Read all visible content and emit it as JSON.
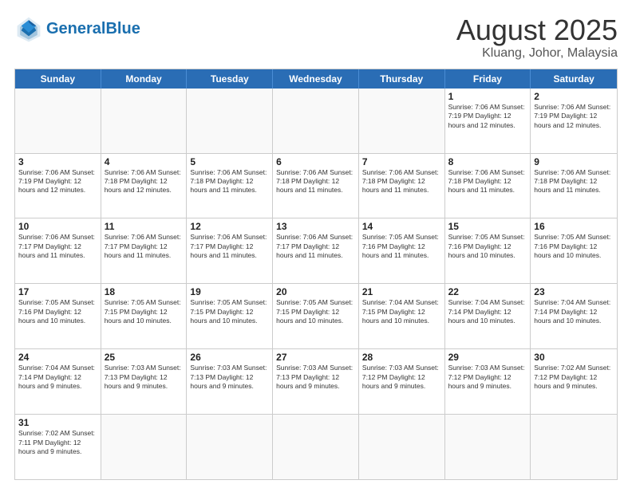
{
  "header": {
    "logo_general": "General",
    "logo_blue": "Blue",
    "month_year": "August 2025",
    "location": "Kluang, Johor, Malaysia"
  },
  "weekdays": [
    "Sunday",
    "Monday",
    "Tuesday",
    "Wednesday",
    "Thursday",
    "Friday",
    "Saturday"
  ],
  "weeks": [
    [
      {
        "day": "",
        "info": ""
      },
      {
        "day": "",
        "info": ""
      },
      {
        "day": "",
        "info": ""
      },
      {
        "day": "",
        "info": ""
      },
      {
        "day": "",
        "info": ""
      },
      {
        "day": "1",
        "info": "Sunrise: 7:06 AM\nSunset: 7:19 PM\nDaylight: 12 hours\nand 12 minutes."
      },
      {
        "day": "2",
        "info": "Sunrise: 7:06 AM\nSunset: 7:19 PM\nDaylight: 12 hours\nand 12 minutes."
      }
    ],
    [
      {
        "day": "3",
        "info": "Sunrise: 7:06 AM\nSunset: 7:19 PM\nDaylight: 12 hours\nand 12 minutes."
      },
      {
        "day": "4",
        "info": "Sunrise: 7:06 AM\nSunset: 7:18 PM\nDaylight: 12 hours\nand 12 minutes."
      },
      {
        "day": "5",
        "info": "Sunrise: 7:06 AM\nSunset: 7:18 PM\nDaylight: 12 hours\nand 11 minutes."
      },
      {
        "day": "6",
        "info": "Sunrise: 7:06 AM\nSunset: 7:18 PM\nDaylight: 12 hours\nand 11 minutes."
      },
      {
        "day": "7",
        "info": "Sunrise: 7:06 AM\nSunset: 7:18 PM\nDaylight: 12 hours\nand 11 minutes."
      },
      {
        "day": "8",
        "info": "Sunrise: 7:06 AM\nSunset: 7:18 PM\nDaylight: 12 hours\nand 11 minutes."
      },
      {
        "day": "9",
        "info": "Sunrise: 7:06 AM\nSunset: 7:18 PM\nDaylight: 12 hours\nand 11 minutes."
      }
    ],
    [
      {
        "day": "10",
        "info": "Sunrise: 7:06 AM\nSunset: 7:17 PM\nDaylight: 12 hours\nand 11 minutes."
      },
      {
        "day": "11",
        "info": "Sunrise: 7:06 AM\nSunset: 7:17 PM\nDaylight: 12 hours\nand 11 minutes."
      },
      {
        "day": "12",
        "info": "Sunrise: 7:06 AM\nSunset: 7:17 PM\nDaylight: 12 hours\nand 11 minutes."
      },
      {
        "day": "13",
        "info": "Sunrise: 7:06 AM\nSunset: 7:17 PM\nDaylight: 12 hours\nand 11 minutes."
      },
      {
        "day": "14",
        "info": "Sunrise: 7:05 AM\nSunset: 7:16 PM\nDaylight: 12 hours\nand 11 minutes."
      },
      {
        "day": "15",
        "info": "Sunrise: 7:05 AM\nSunset: 7:16 PM\nDaylight: 12 hours\nand 10 minutes."
      },
      {
        "day": "16",
        "info": "Sunrise: 7:05 AM\nSunset: 7:16 PM\nDaylight: 12 hours\nand 10 minutes."
      }
    ],
    [
      {
        "day": "17",
        "info": "Sunrise: 7:05 AM\nSunset: 7:16 PM\nDaylight: 12 hours\nand 10 minutes."
      },
      {
        "day": "18",
        "info": "Sunrise: 7:05 AM\nSunset: 7:15 PM\nDaylight: 12 hours\nand 10 minutes."
      },
      {
        "day": "19",
        "info": "Sunrise: 7:05 AM\nSunset: 7:15 PM\nDaylight: 12 hours\nand 10 minutes."
      },
      {
        "day": "20",
        "info": "Sunrise: 7:05 AM\nSunset: 7:15 PM\nDaylight: 12 hours\nand 10 minutes."
      },
      {
        "day": "21",
        "info": "Sunrise: 7:04 AM\nSunset: 7:15 PM\nDaylight: 12 hours\nand 10 minutes."
      },
      {
        "day": "22",
        "info": "Sunrise: 7:04 AM\nSunset: 7:14 PM\nDaylight: 12 hours\nand 10 minutes."
      },
      {
        "day": "23",
        "info": "Sunrise: 7:04 AM\nSunset: 7:14 PM\nDaylight: 12 hours\nand 10 minutes."
      }
    ],
    [
      {
        "day": "24",
        "info": "Sunrise: 7:04 AM\nSunset: 7:14 PM\nDaylight: 12 hours\nand 9 minutes."
      },
      {
        "day": "25",
        "info": "Sunrise: 7:03 AM\nSunset: 7:13 PM\nDaylight: 12 hours\nand 9 minutes."
      },
      {
        "day": "26",
        "info": "Sunrise: 7:03 AM\nSunset: 7:13 PM\nDaylight: 12 hours\nand 9 minutes."
      },
      {
        "day": "27",
        "info": "Sunrise: 7:03 AM\nSunset: 7:13 PM\nDaylight: 12 hours\nand 9 minutes."
      },
      {
        "day": "28",
        "info": "Sunrise: 7:03 AM\nSunset: 7:12 PM\nDaylight: 12 hours\nand 9 minutes."
      },
      {
        "day": "29",
        "info": "Sunrise: 7:03 AM\nSunset: 7:12 PM\nDaylight: 12 hours\nand 9 minutes."
      },
      {
        "day": "30",
        "info": "Sunrise: 7:02 AM\nSunset: 7:12 PM\nDaylight: 12 hours\nand 9 minutes."
      }
    ],
    [
      {
        "day": "31",
        "info": "Sunrise: 7:02 AM\nSunset: 7:11 PM\nDaylight: 12 hours\nand 9 minutes."
      },
      {
        "day": "",
        "info": ""
      },
      {
        "day": "",
        "info": ""
      },
      {
        "day": "",
        "info": ""
      },
      {
        "day": "",
        "info": ""
      },
      {
        "day": "",
        "info": ""
      },
      {
        "day": "",
        "info": ""
      }
    ]
  ]
}
